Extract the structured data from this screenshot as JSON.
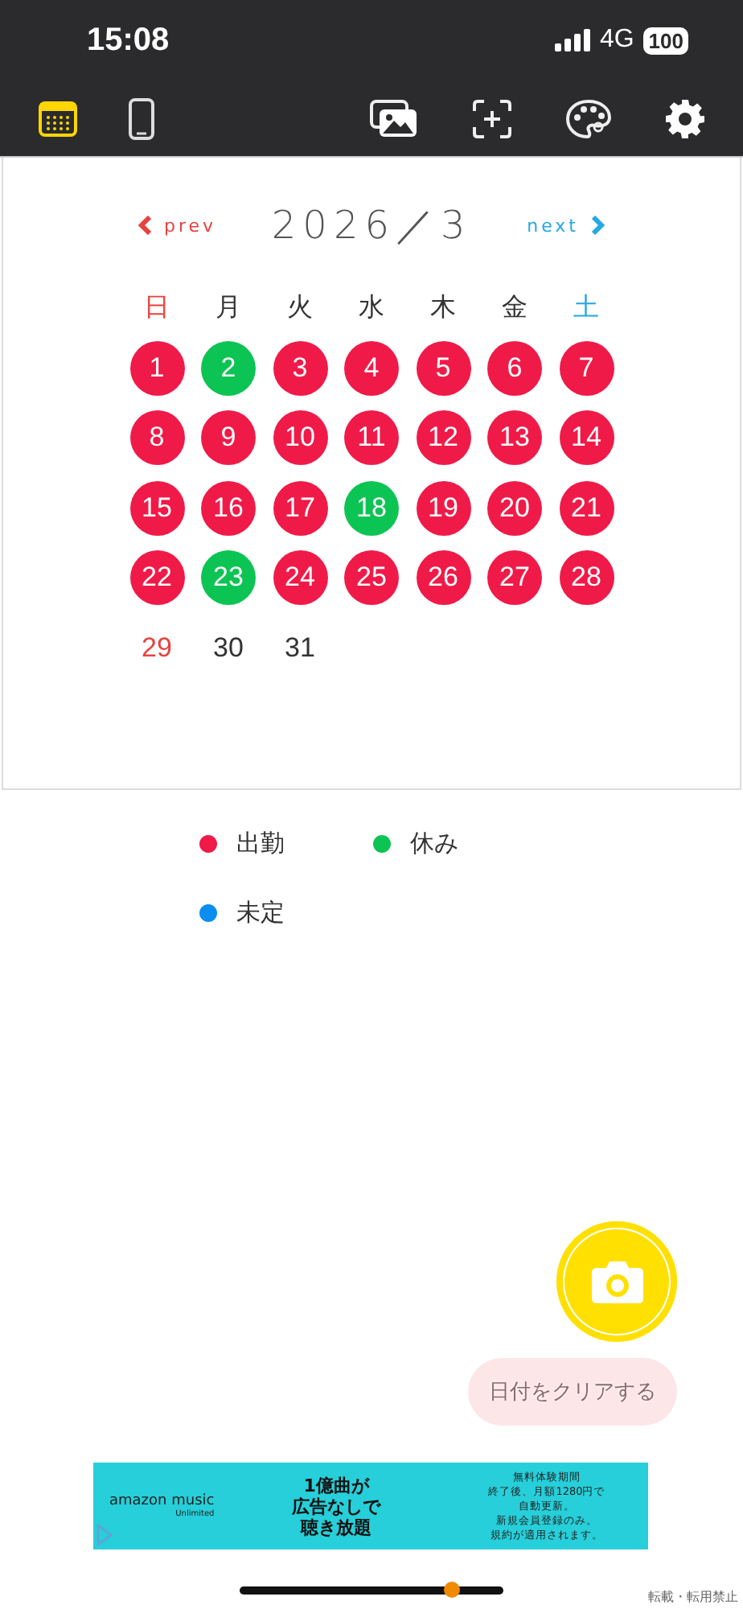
{
  "status_bar": {
    "time": "15:08",
    "network": "4G",
    "battery": "100"
  },
  "toolbar": {
    "tabs": [
      {
        "kind": "calendar",
        "selected": true
      },
      {
        "kind": "phone",
        "selected": false
      }
    ]
  },
  "calendar": {
    "prev": "prev",
    "title": "2026／3",
    "next": "next",
    "weekdays": [
      {
        "label": "日",
        "kind": "sunday"
      },
      {
        "label": "月",
        "kind": "weekday"
      },
      {
        "label": "火",
        "kind": "weekday"
      },
      {
        "label": "水",
        "kind": "weekday"
      },
      {
        "label": "木",
        "kind": "weekday"
      },
      {
        "label": "金",
        "kind": "weekday"
      },
      {
        "label": "土",
        "kind": "saturday"
      }
    ],
    "days": [
      {
        "label": "1",
        "color": "#f01a48"
      },
      {
        "label": "2",
        "color": "#0cc453"
      },
      {
        "label": "3",
        "color": "#f01a48"
      },
      {
        "label": "4",
        "color": "#f01a48"
      },
      {
        "label": "5",
        "color": "#f01a48"
      },
      {
        "label": "6",
        "color": "#f01a48"
      },
      {
        "label": "7",
        "color": "#f01a48"
      },
      {
        "label": "8",
        "color": "#f01a48"
      },
      {
        "label": "9",
        "color": "#f01a48"
      },
      {
        "label": "10",
        "color": "#f01a48"
      },
      {
        "label": "11",
        "color": "#f01a48"
      },
      {
        "label": "12",
        "color": "#f01a48"
      },
      {
        "label": "13",
        "color": "#f01a48"
      },
      {
        "label": "14",
        "color": "#f01a48"
      },
      {
        "label": "15",
        "color": "#f01a48"
      },
      {
        "label": "16",
        "color": "#f01a48"
      },
      {
        "label": "17",
        "color": "#f01a48"
      },
      {
        "label": "18",
        "color": "#0cc453"
      },
      {
        "label": "19",
        "color": "#f01a48"
      },
      {
        "label": "20",
        "color": "#f01a48"
      },
      {
        "label": "21",
        "color": "#f01a48"
      },
      {
        "label": "22",
        "color": "#f01a48"
      },
      {
        "label": "23",
        "color": "#0cc453"
      },
      {
        "label": "24",
        "color": "#f01a48"
      },
      {
        "label": "25",
        "color": "#f01a48"
      },
      {
        "label": "26",
        "color": "#f01a48"
      },
      {
        "label": "27",
        "color": "#f01a48"
      },
      {
        "label": "28",
        "color": "#f01a48"
      },
      {
        "label": "29",
        "kind": "sunday"
      },
      {
        "label": "30",
        "kind": "weekday"
      },
      {
        "label": "31",
        "kind": "weekday"
      }
    ]
  },
  "legend": [
    {
      "label": "出勤",
      "color": "#f01a48"
    },
    {
      "label": "休み",
      "color": "#0cc453"
    },
    {
      "label": "未定",
      "color": "#0a8ff0"
    }
  ],
  "clear_button": "日付をクリアする",
  "ad": {
    "logo": "amazon music",
    "logo_sub": "Unlimited",
    "headline": [
      "1億曲が",
      "広告なしで",
      "聴き放題"
    ],
    "notes": [
      "無料体験期間",
      "終了後、月額1280円で",
      "自動更新。",
      "新規会員登録のみ。",
      "規約が適用されます。"
    ]
  },
  "footer_note": "転載・転用禁止"
}
